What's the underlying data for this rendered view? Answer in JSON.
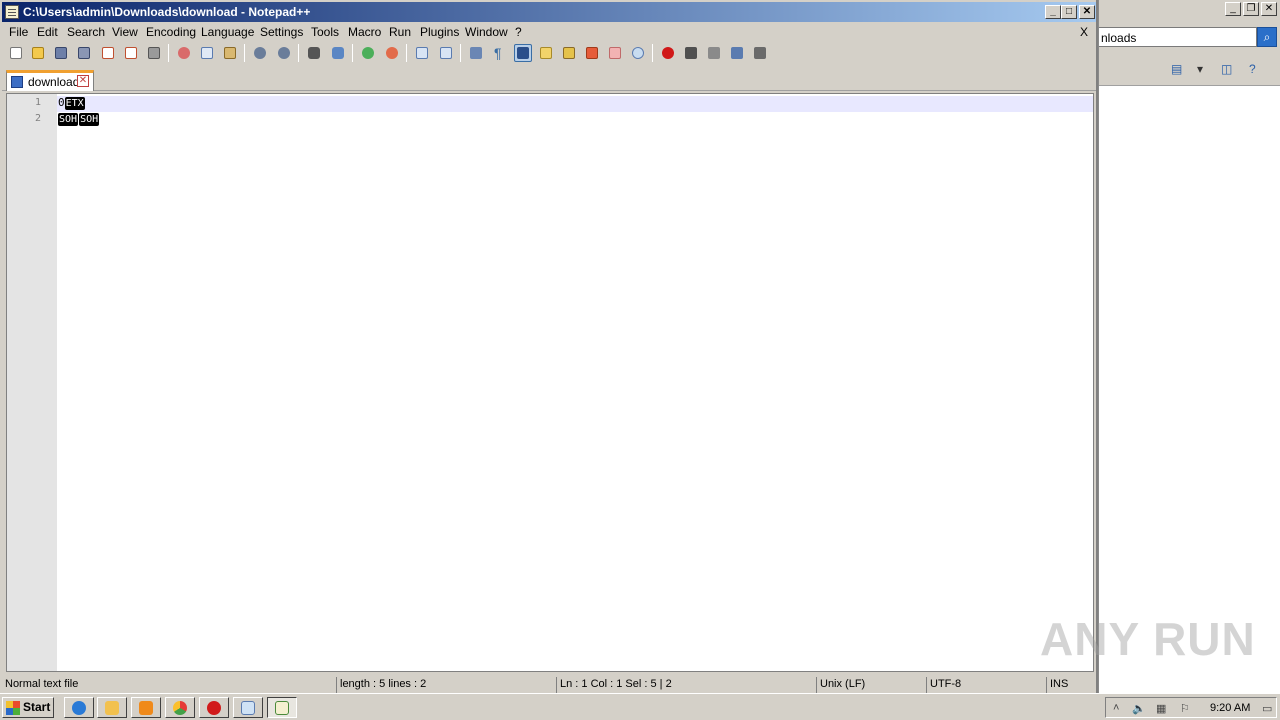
{
  "window": {
    "title": "C:\\Users\\admin\\Downloads\\download - Notepad++",
    "minimize": "_",
    "maximize": "□",
    "close": "✕"
  },
  "menu": [
    "File",
    "Edit",
    "Search",
    "View",
    "Encoding",
    "Language",
    "Settings",
    "Tools",
    "Macro",
    "Run",
    "Plugins",
    "Window",
    "?"
  ],
  "menu_close": "X",
  "toolbar_icons": [
    "new-file-icon",
    "open-file-icon",
    "save-icon",
    "save-all-icon",
    "close-icon",
    "close-all-icon",
    "print-icon",
    "cut-icon",
    "copy-icon",
    "paste-icon",
    "undo-icon",
    "redo-icon",
    "find-icon",
    "replace-icon",
    "zoom-in-icon",
    "zoom-out-icon",
    "sync-vertical-icon",
    "sync-horizontal-icon",
    "word-wrap-icon",
    "show-all-chars-icon",
    "indent-guide-icon",
    "language-icon",
    "function-list-icon",
    "doc-map-icon",
    "folder-workspace-icon",
    "monitor-icon",
    "record-macro-icon",
    "stop-macro-icon",
    "play-macro-icon",
    "run-macro-multiple-icon",
    "save-macro-icon"
  ],
  "tab": {
    "label": "download",
    "close": "✕"
  },
  "editor": {
    "line_numbers": [
      "1",
      "2"
    ],
    "lines": [
      [
        {
          "text": "0",
          "ctrl": false
        },
        {
          "text": "ETX",
          "ctrl": true
        }
      ],
      [
        {
          "text": "SOH",
          "ctrl": true
        },
        {
          "text": "SOH",
          "ctrl": true
        }
      ]
    ]
  },
  "status": {
    "file_type": "Normal text file",
    "length": "length : 5    lines : 2",
    "position": "Ln : 1    Col : 1    Sel : 5 | 2",
    "eol": "Unix (LF)",
    "encoding": "UTF-8",
    "mode": "INS"
  },
  "background_window": {
    "search_text": "nloads",
    "minimize": "_",
    "restore": "❐",
    "close": "✕"
  },
  "taskbar": {
    "start_label": "Start",
    "apps": [
      "internet-explorer-icon",
      "file-explorer-icon",
      "media-player-icon",
      "chrome-icon",
      "opera-icon",
      "notepad-icon",
      "notepad-plus-plus-icon"
    ],
    "clock": "9:20 AM"
  },
  "watermark": "ANY RUN",
  "colors": {
    "title_start": "#0a246a",
    "title_end": "#a6caf0",
    "current_line": "#e8e8ff",
    "tab_accent": "#f0a030"
  }
}
